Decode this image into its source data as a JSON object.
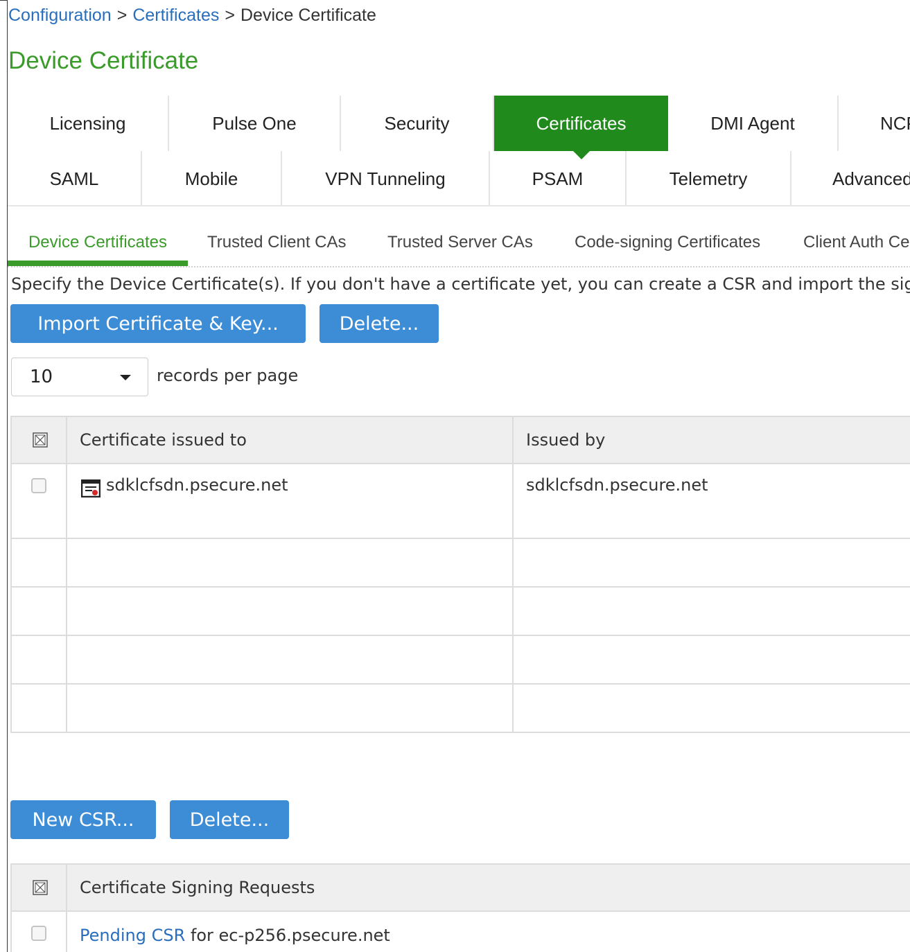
{
  "breadcrumb": {
    "items": [
      {
        "label": "Configuration",
        "link": true
      },
      {
        "label": "Certificates",
        "link": true
      },
      {
        "label": "Device Certificate",
        "link": false
      }
    ],
    "separator": ">"
  },
  "page_title": "Device Certificate",
  "main_tabs": {
    "row1": [
      "Licensing",
      "Pulse One",
      "Security",
      "Certificates",
      "DMI Agent",
      "NCP"
    ],
    "row2": [
      "SAML",
      "Mobile",
      "VPN Tunneling",
      "PSAM",
      "Telemetry",
      "Advanced"
    ],
    "active": "Certificates"
  },
  "sub_tabs": {
    "items": [
      "Device Certificates",
      "Trusted Client CAs",
      "Trusted Server CAs",
      "Code-signing Certificates",
      "Client Auth Certificates"
    ],
    "active": "Device Certificates"
  },
  "description": "Specify the Device Certificate(s). If you don't have a certificate yet, you can create a CSR and import the signed certificate.",
  "cert_buttons": {
    "import_label": "Import Certificate & Key...",
    "delete_label": "Delete..."
  },
  "records": {
    "value": "10",
    "label": "records per page"
  },
  "cert_table": {
    "headers": [
      "Certificate issued to",
      "Issued by"
    ],
    "rows": [
      {
        "issued_to": "sdklcfsdn.psecure.net",
        "issued_by": "sdklcfsdn.psecure.net"
      }
    ]
  },
  "csr_buttons": {
    "new_label": "New CSR...",
    "delete_label": "Delete..."
  },
  "csr_table": {
    "header": "Certificate Signing Requests",
    "rows": [
      {
        "link_text": "Pending CSR",
        "rest": " for ec-p256.psecure.net"
      }
    ]
  },
  "colors": {
    "accent_green": "#218a1c",
    "title_green": "#3a9a2a",
    "link_blue": "#2a6ebb",
    "button_blue": "#3c8dd6"
  }
}
